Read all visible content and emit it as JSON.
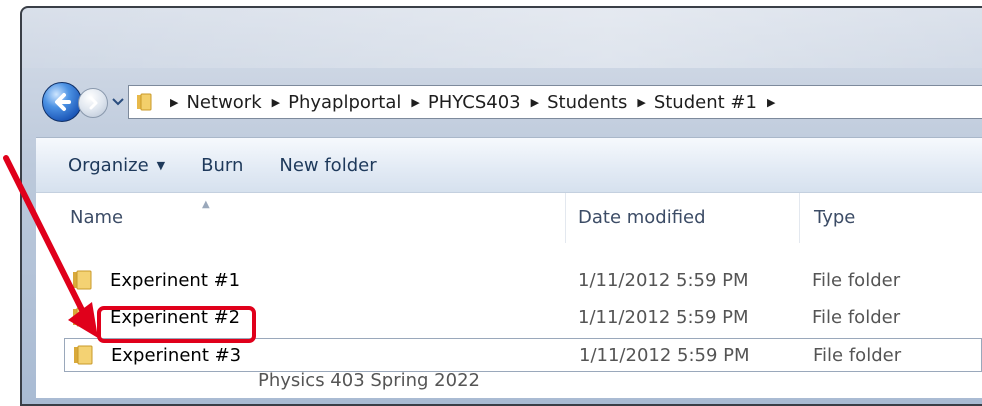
{
  "nav": {
    "back_icon": "back-arrow-icon",
    "forward_icon": "forward-arrow-icon",
    "dropdown_icon": "chevron-down-icon",
    "breadcrumb": [
      "Network",
      "Phyaplportal",
      "PHYCS403",
      "Students",
      "Student #1"
    ]
  },
  "toolbar": {
    "organize_label": "Organize",
    "burn_label": "Burn",
    "new_folder_label": "New folder"
  },
  "columns": {
    "name": "Name",
    "date": "Date modified",
    "type": "Type"
  },
  "files": [
    {
      "name": "Experinent #1",
      "date": "1/11/2012 5:59 PM",
      "type": "File folder"
    },
    {
      "name": "Experinent #2",
      "date": "1/11/2012 5:59 PM",
      "type": "File folder"
    },
    {
      "name": "Experinent #3",
      "date": "1/11/2012 5:59 PM",
      "type": "File folder"
    }
  ],
  "annotation": {
    "highlight_color": "#e0001b",
    "highlighted_item": "Experinent #2"
  },
  "footer_text": "Physics 403 Spring 2022"
}
